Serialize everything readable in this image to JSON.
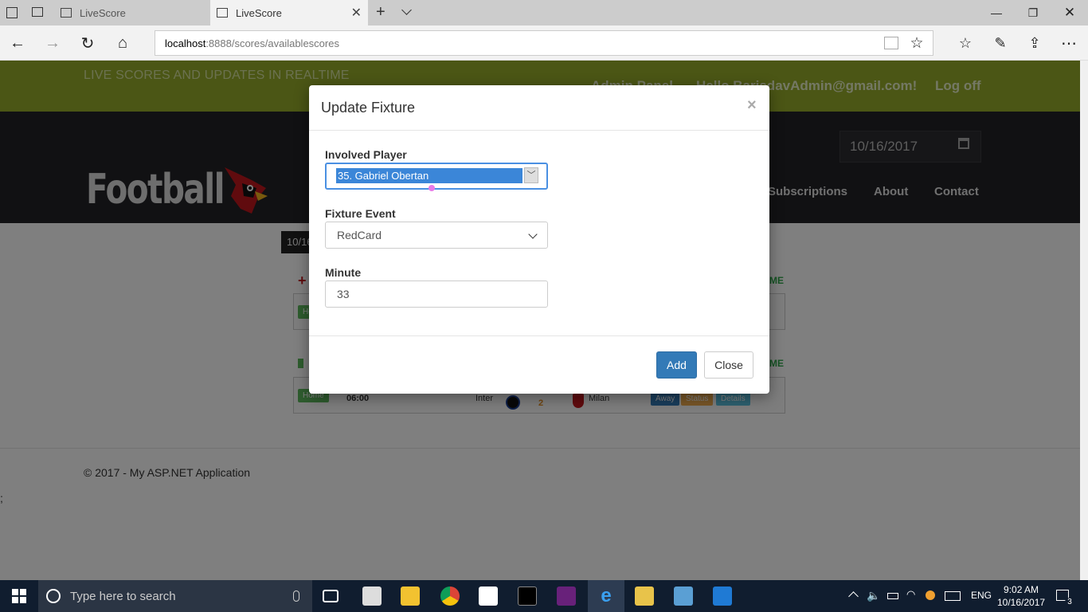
{
  "browser": {
    "tabs": [
      {
        "label": "LiveScore"
      },
      {
        "label": "LiveScore"
      }
    ],
    "address_host": "localhost",
    "address_path": ":8888/scores/availablescores"
  },
  "site": {
    "tagline": "LIVE SCORES AND UPDATES IN REALTIME",
    "admin_link": "Admin Panel",
    "hello_text": "Hello BarisdavAdmin@gmail.com!",
    "logoff": "Log off",
    "brand": "Football",
    "date_value": "10/16/2017",
    "nav": [
      "Subscriptions",
      "About",
      "Contact"
    ],
    "date_tag": "10/16",
    "copyright": "© 2017 - My ASP.NET Application",
    "stray_text": ";"
  },
  "fixtures": [
    {
      "home_badge": "Home"
    },
    {
      "home_badge": "Home",
      "time": "06:00",
      "home_team": "Inter",
      "score": "2",
      "away_team": "Milan",
      "btn_away": "Away",
      "btn_status": "Status",
      "btn_details": "Details"
    }
  ],
  "modal": {
    "title": "Update Fixture",
    "close_x": "×",
    "player_label": "Involved Player",
    "player_value": "35. Gabriel Obertan",
    "event_label": "Fixture Event",
    "event_value": "RedCard",
    "minute_label": "Minute",
    "minute_value": "33",
    "add_label": "Add",
    "close_label": "Close"
  },
  "taskbar": {
    "search_placeholder": "Type here to search",
    "language": "ENG",
    "time": "9:02 AM",
    "date": "10/16/2017",
    "notifications": "3"
  },
  "colors": {
    "accent_green": "#96ad2a",
    "primary_button": "#337ab7"
  }
}
